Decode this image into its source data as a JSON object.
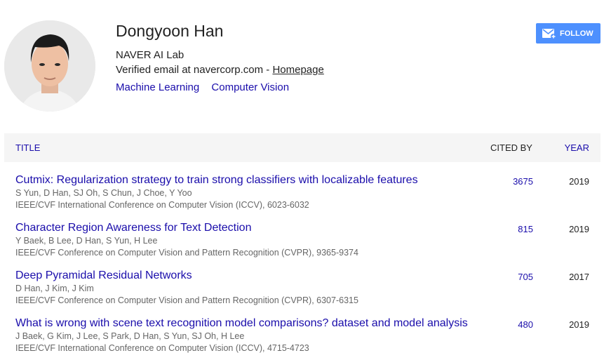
{
  "profile": {
    "name": "Dongyoon Han",
    "affiliation": "NAVER AI Lab",
    "email_text": "Verified email at navercorp.com - ",
    "homepage_label": "Homepage",
    "interests": [
      "Machine Learning",
      "Computer Vision"
    ],
    "follow_label": "FOLLOW",
    "follow_icon": "mail-plus-icon"
  },
  "table": {
    "headers": {
      "title": "TITLE",
      "cited_by": "CITED BY",
      "year": "YEAR"
    },
    "rows": [
      {
        "title": "Cutmix: Regularization strategy to train strong classifiers with localizable features",
        "authors": "S Yun, D Han, SJ Oh, S Chun, J Choe, Y Yoo",
        "venue": "IEEE/CVF International Conference on Computer Vision (ICCV), 6023-6032",
        "cited_by": "3675",
        "year": "2019"
      },
      {
        "title": "Character Region Awareness for Text Detection",
        "authors": "Y Baek, B Lee, D Han, S Yun, H Lee",
        "venue": "IEEE/CVF Conference on Computer Vision and Pattern Recognition (CVPR), 9365-9374",
        "cited_by": "815",
        "year": "2019"
      },
      {
        "title": "Deep Pyramidal Residual Networks",
        "authors": "D Han, J Kim, J Kim",
        "venue": "IEEE/CVF Conference on Computer Vision and Pattern Recognition (CVPR), 6307-6315",
        "cited_by": "705",
        "year": "2017"
      },
      {
        "title": "What is wrong with scene text recognition model comparisons? dataset and model analysis",
        "authors": "J Baek, G Kim, J Lee, S Park, D Han, S Yun, SJ Oh, H Lee",
        "venue": "IEEE/CVF International Conference on Computer Vision (ICCV), 4715-4723",
        "cited_by": "480",
        "year": "2019"
      }
    ]
  },
  "colors": {
    "link": "#1a0dab",
    "follow_button": "#4d90fe",
    "header_bg": "#f5f5f5"
  }
}
